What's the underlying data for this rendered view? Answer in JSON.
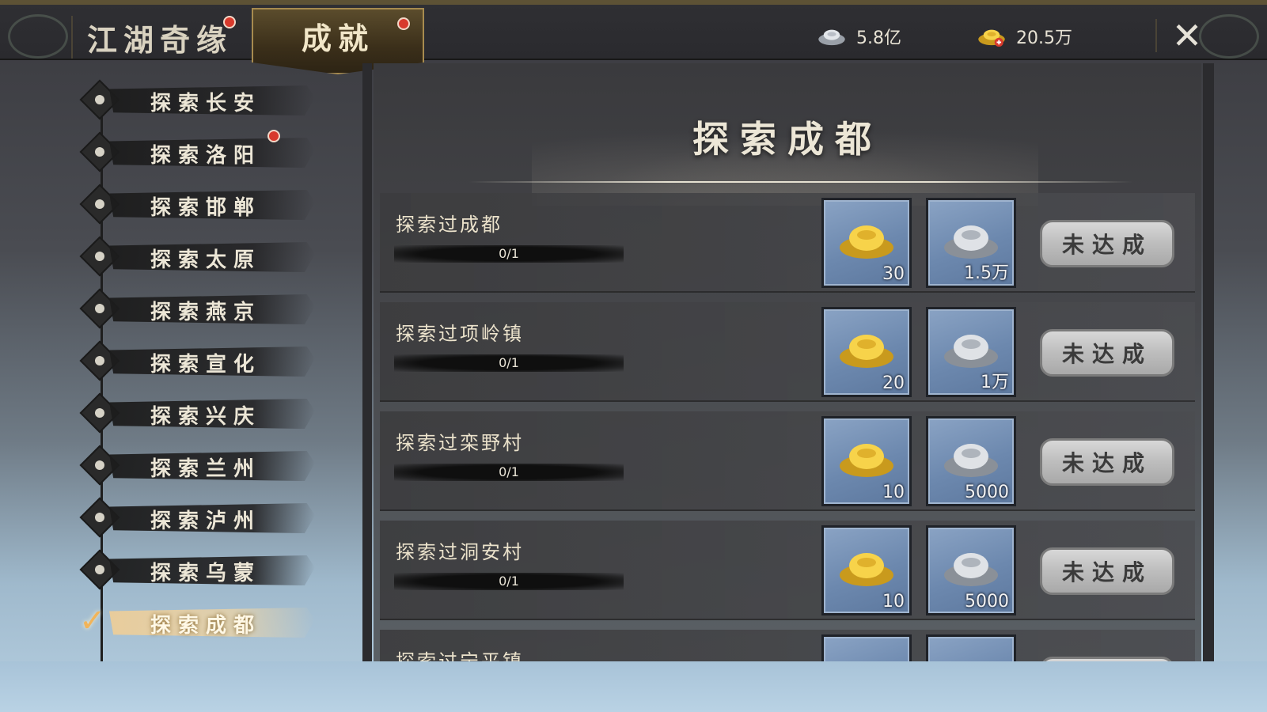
{
  "top_tabs": [
    {
      "label": "江湖奇缘",
      "has_notice": true,
      "active": false
    },
    {
      "label": "成就",
      "has_notice": true,
      "active": true
    }
  ],
  "currencies": [
    {
      "icon": "silver-ingot-icon",
      "value": "5.8亿"
    },
    {
      "icon": "gold-ingot-icon",
      "value": "20.5万"
    }
  ],
  "sidebar": {
    "items": [
      {
        "label": "探索长安",
        "has_notice": false
      },
      {
        "label": "探索洛阳",
        "has_notice": true
      },
      {
        "label": "探索邯郸",
        "has_notice": false
      },
      {
        "label": "探索太原",
        "has_notice": false
      },
      {
        "label": "探索燕京",
        "has_notice": false
      },
      {
        "label": "探索宣化",
        "has_notice": false
      },
      {
        "label": "探索兴庆",
        "has_notice": false
      },
      {
        "label": "探索兰州",
        "has_notice": false
      },
      {
        "label": "探索泸州",
        "has_notice": false
      },
      {
        "label": "探索乌蒙",
        "has_notice": false
      },
      {
        "label": "探索成都",
        "has_notice": false,
        "active": true
      }
    ]
  },
  "panel": {
    "title": "探索成都",
    "rows": [
      {
        "name": "探索过成都",
        "progress": "0/1",
        "rewards": [
          {
            "type": "gold",
            "qty": "30"
          },
          {
            "type": "silver",
            "qty": "1.5万"
          }
        ],
        "status": "未达成"
      },
      {
        "name": "探索过项岭镇",
        "progress": "0/1",
        "rewards": [
          {
            "type": "gold",
            "qty": "20"
          },
          {
            "type": "silver",
            "qty": "1万"
          }
        ],
        "status": "未达成"
      },
      {
        "name": "探索过栾野村",
        "progress": "0/1",
        "rewards": [
          {
            "type": "gold",
            "qty": "10"
          },
          {
            "type": "silver",
            "qty": "5000"
          }
        ],
        "status": "未达成"
      },
      {
        "name": "探索过洞安村",
        "progress": "0/1",
        "rewards": [
          {
            "type": "gold",
            "qty": "10"
          },
          {
            "type": "silver",
            "qty": "5000"
          }
        ],
        "status": "未达成"
      },
      {
        "name": "探索过宁平镇",
        "progress": "",
        "rewards": [
          {
            "type": "gold",
            "qty": ""
          },
          {
            "type": "silver",
            "qty": ""
          }
        ],
        "status": ""
      }
    ]
  },
  "colors": {
    "accent_gold": "#a78b4f",
    "notice_red": "#d83a2c",
    "slot_blue": "#6c88ae",
    "status_grey": "#bdbdbd"
  }
}
